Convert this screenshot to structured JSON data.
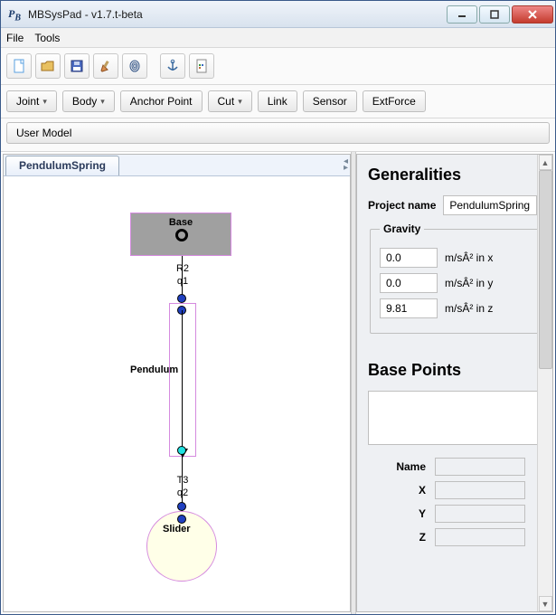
{
  "window": {
    "title": "MBSysPad - v1.7.t-beta"
  },
  "menu": {
    "file": "File",
    "tools": "Tools"
  },
  "toolbar_icons": {
    "new": "new",
    "open": "open",
    "save": "save",
    "cut_model": "cut_model",
    "fingerprint": "fingerprint",
    "anchor_tool": "anchor_tool",
    "export": "export"
  },
  "buttons": {
    "joint": "Joint",
    "body": "Body",
    "anchor_point": "Anchor Point",
    "cut": "Cut",
    "link": "Link",
    "sensor": "Sensor",
    "extforce": "ExtForce",
    "user_model": "User Model"
  },
  "tab": {
    "label": "PendulumSpring"
  },
  "diagram": {
    "base": "Base",
    "joint1_name": "R2",
    "joint1_coord": "q1",
    "body1": "Pendulum",
    "joint2_name": "T3",
    "joint2_coord": "q2",
    "body2": "Slider"
  },
  "panel": {
    "generalities": "Generalities",
    "project_name_label": "Project name",
    "project_name_value": "PendulumSpring",
    "gravity_legend": "Gravity",
    "gx": "0.0",
    "gx_unit": "m/sÂ² in x",
    "gy": "0.0",
    "gy_unit": "m/sÂ² in y",
    "gz": "9.81",
    "gz_unit": "m/sÂ² in z",
    "base_points": "Base Points",
    "name_label": "Name",
    "x_label": "X",
    "y_label": "Y",
    "z_label": "Z"
  }
}
